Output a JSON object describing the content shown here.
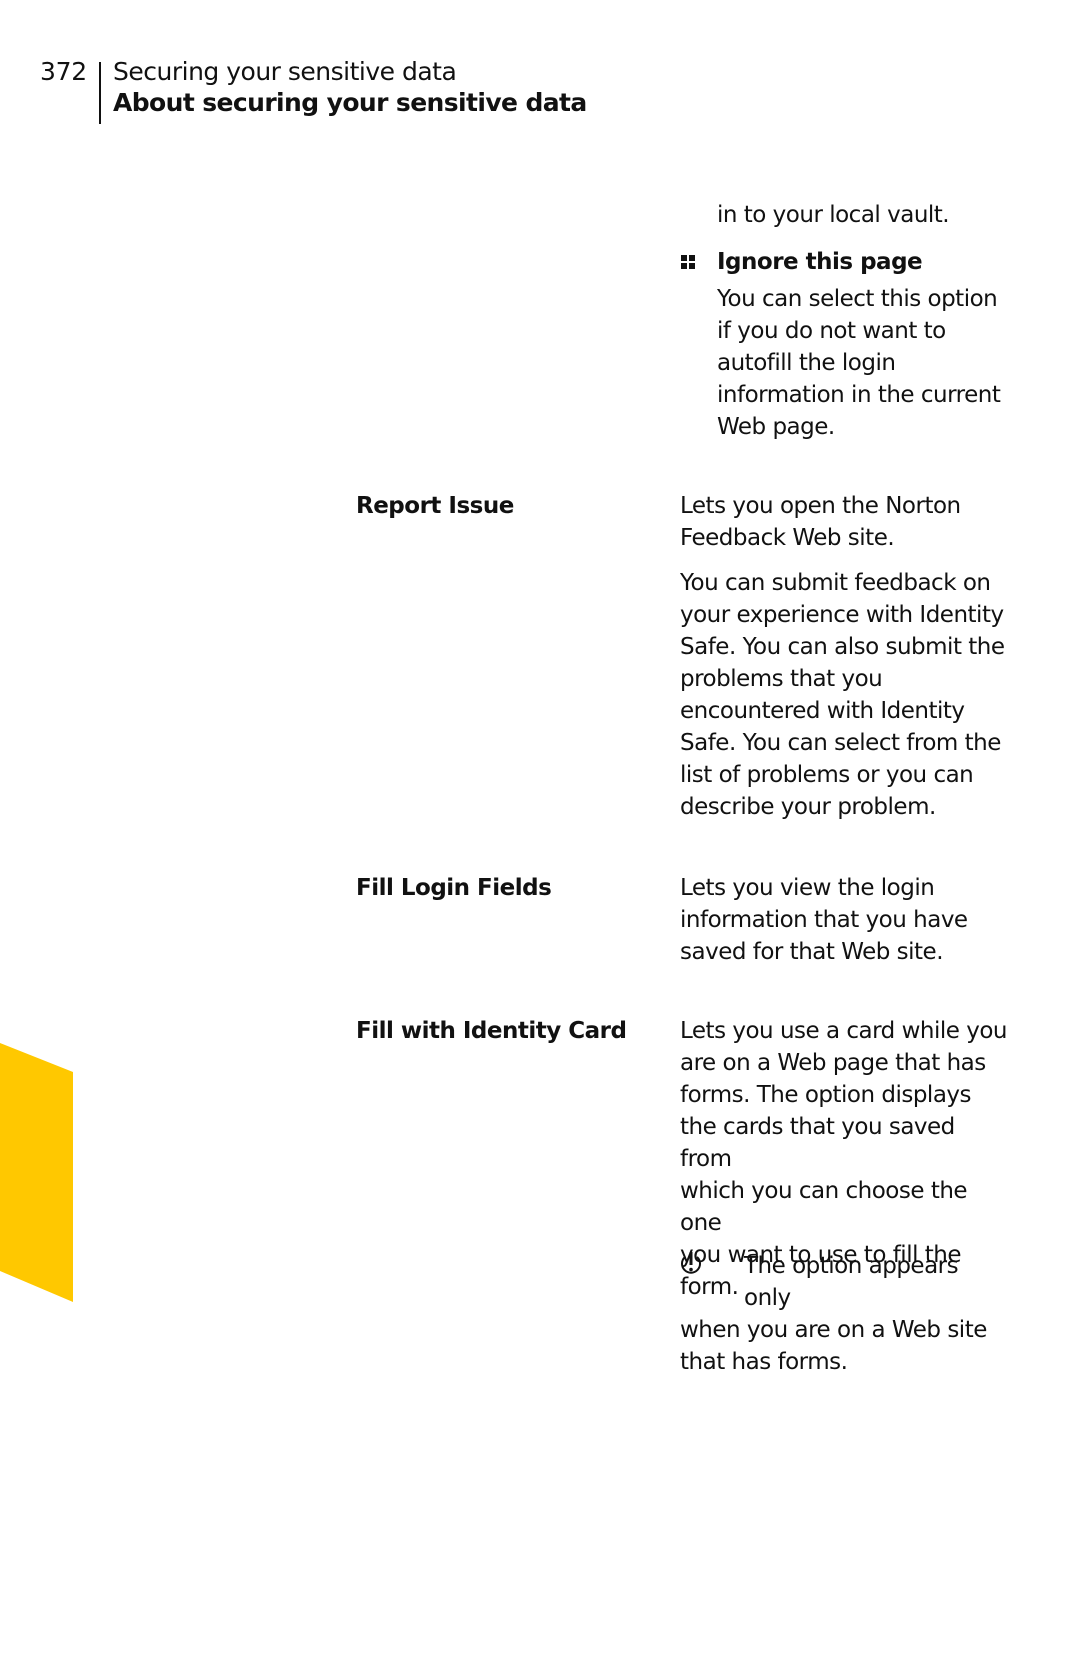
{
  "header": {
    "page_number": "372",
    "chapter": "Securing your sensitive data",
    "section": "About securing your sensitive data"
  },
  "colors": {
    "tab": "#FFC800",
    "text": "#111111"
  },
  "continuation": {
    "text": "in to your local vault.",
    "bullet": {
      "icon": "square-bullet-icon",
      "title": "Ignore this page",
      "lines": [
        "You can select this option",
        "if you do not want to",
        "autofill the login",
        "information in the current",
        "Web page."
      ]
    }
  },
  "rows": [
    {
      "label": "Report Issue",
      "paragraphs": [
        [
          "Lets you open the Norton",
          "Feedback Web site."
        ],
        [
          "You can submit feedback on",
          "your experience with Identity",
          "Safe. You can also submit the",
          "problems that you",
          "encountered with Identity",
          "Safe. You can select from the",
          "list of problems or you can",
          "describe your problem."
        ]
      ]
    },
    {
      "label": "Fill Login Fields",
      "paragraphs": [
        [
          "Lets you view the login",
          "information that you have",
          "saved for that Web site."
        ]
      ]
    },
    {
      "label": "Fill with Identity Card",
      "paragraphs": [
        [
          "Lets you use a card while you",
          "are on a Web page that has",
          "forms. The option displays",
          "the cards that you saved from",
          "which you can choose the one",
          "you want to use to fill the",
          "form."
        ]
      ],
      "note": {
        "icon": "warning-note-icon",
        "lines": [
          "The option appears only",
          "when you are on a Web site",
          "that has forms."
        ]
      }
    }
  ]
}
